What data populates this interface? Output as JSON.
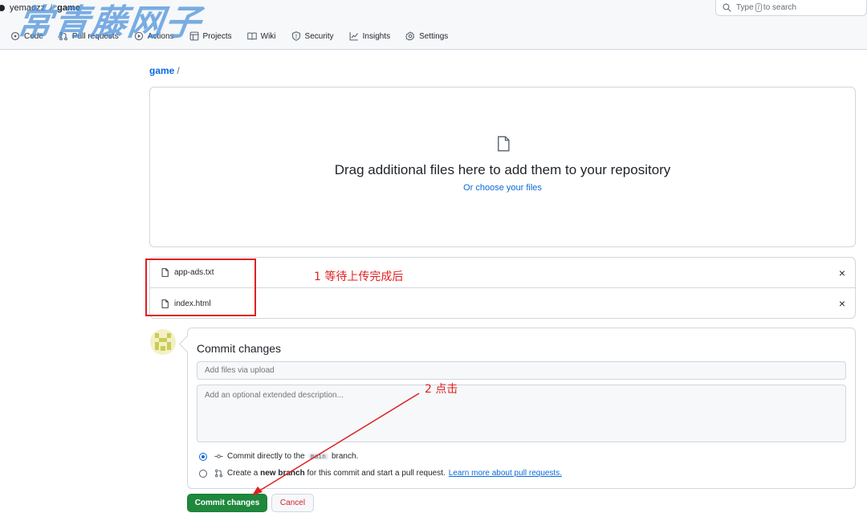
{
  "repo": {
    "owner": "yemaozz",
    "separator": "/",
    "name": "game"
  },
  "search": {
    "prefix": "Type",
    "key": "/",
    "suffix": "to search"
  },
  "tabs": [
    {
      "label": "Code",
      "icon": "code-icon"
    },
    {
      "label": "Pull requests",
      "icon": "pull-request-icon"
    },
    {
      "label": "Actions",
      "icon": "play-icon"
    },
    {
      "label": "Projects",
      "icon": "table-icon"
    },
    {
      "label": "Wiki",
      "icon": "book-icon"
    },
    {
      "label": "Security",
      "icon": "shield-icon"
    },
    {
      "label": "Insights",
      "icon": "graph-icon"
    },
    {
      "label": "Settings",
      "icon": "gear-icon"
    }
  ],
  "watermark": "常青藤网子",
  "breadcrumb": {
    "repo": "game",
    "slash": "/"
  },
  "dropzone": {
    "title": "Drag additional files here to add them to your repository",
    "choose_prefix": "Or",
    "choose_link": "choose your files"
  },
  "files": [
    {
      "name": "app-ads.txt",
      "remove": "×"
    },
    {
      "name": "index.html",
      "remove": "×"
    }
  ],
  "annotations": {
    "step1": "1 等待上传完成后",
    "step2": "2 点击",
    "color": "#e02020"
  },
  "commit": {
    "title": "Commit changes",
    "summary_placeholder": "Add files via upload",
    "description_placeholder": "Add an optional extended description...",
    "option_direct_prefix": "Commit directly to the",
    "option_direct_branch": "main",
    "option_direct_suffix": "branch.",
    "option_new_prefix": "Create a",
    "option_new_bold": "new branch",
    "option_new_suffix": "for this commit and start a pull request.",
    "option_new_link": "Learn more about pull requests.",
    "commit_button": "Commit changes",
    "cancel_button": "Cancel"
  },
  "colors": {
    "primary_button": "#1f883d",
    "link": "#0969da",
    "cancel_text": "#cf222e"
  }
}
